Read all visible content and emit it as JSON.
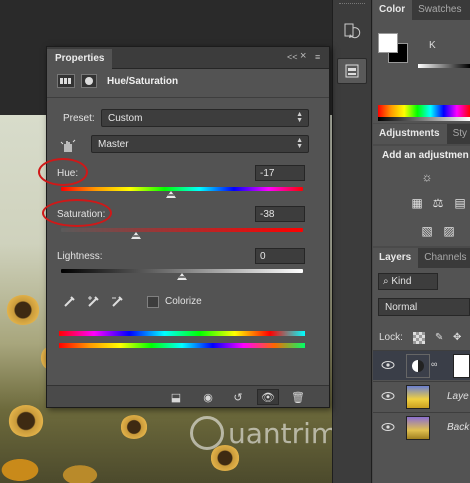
{
  "right_panels": {
    "color_tabs": [
      "Color",
      "Swatches"
    ],
    "color_k_label": "K",
    "adjustments_tabs": [
      "Adjustments",
      "Sty"
    ],
    "adjustments_hint": "Add an adjustmen",
    "layers_tabs": [
      "Layers",
      "Channels"
    ],
    "kind_label": "Kind",
    "blend_mode": "Normal",
    "lock_label": "Lock:",
    "layers": [
      {
        "name": "",
        "type": "adjustment"
      },
      {
        "name": "Laye",
        "type": "image"
      },
      {
        "name": "Back",
        "type": "image"
      }
    ]
  },
  "properties": {
    "tab_label": "Properties",
    "collapse_glyph": "<<",
    "close_glyph": "×",
    "header_title": "Hue/Saturation",
    "preset_label": "Preset:",
    "preset_value": "Custom",
    "channel_value": "Master",
    "hue_label": "Hue:",
    "hue_value": "-17",
    "saturation_label": "Saturation:",
    "saturation_value": "-38",
    "lightness_label": "Lightness:",
    "lightness_value": "0",
    "colorize_label": "Colorize",
    "hue_level": -17,
    "saturation_level": -38,
    "lightness_level": 0
  },
  "watermark": "uantrimang",
  "colors": {
    "highlight_ring": "#d01818",
    "panel_bg": "#535353",
    "dark_bg": "#3a3a3a"
  }
}
